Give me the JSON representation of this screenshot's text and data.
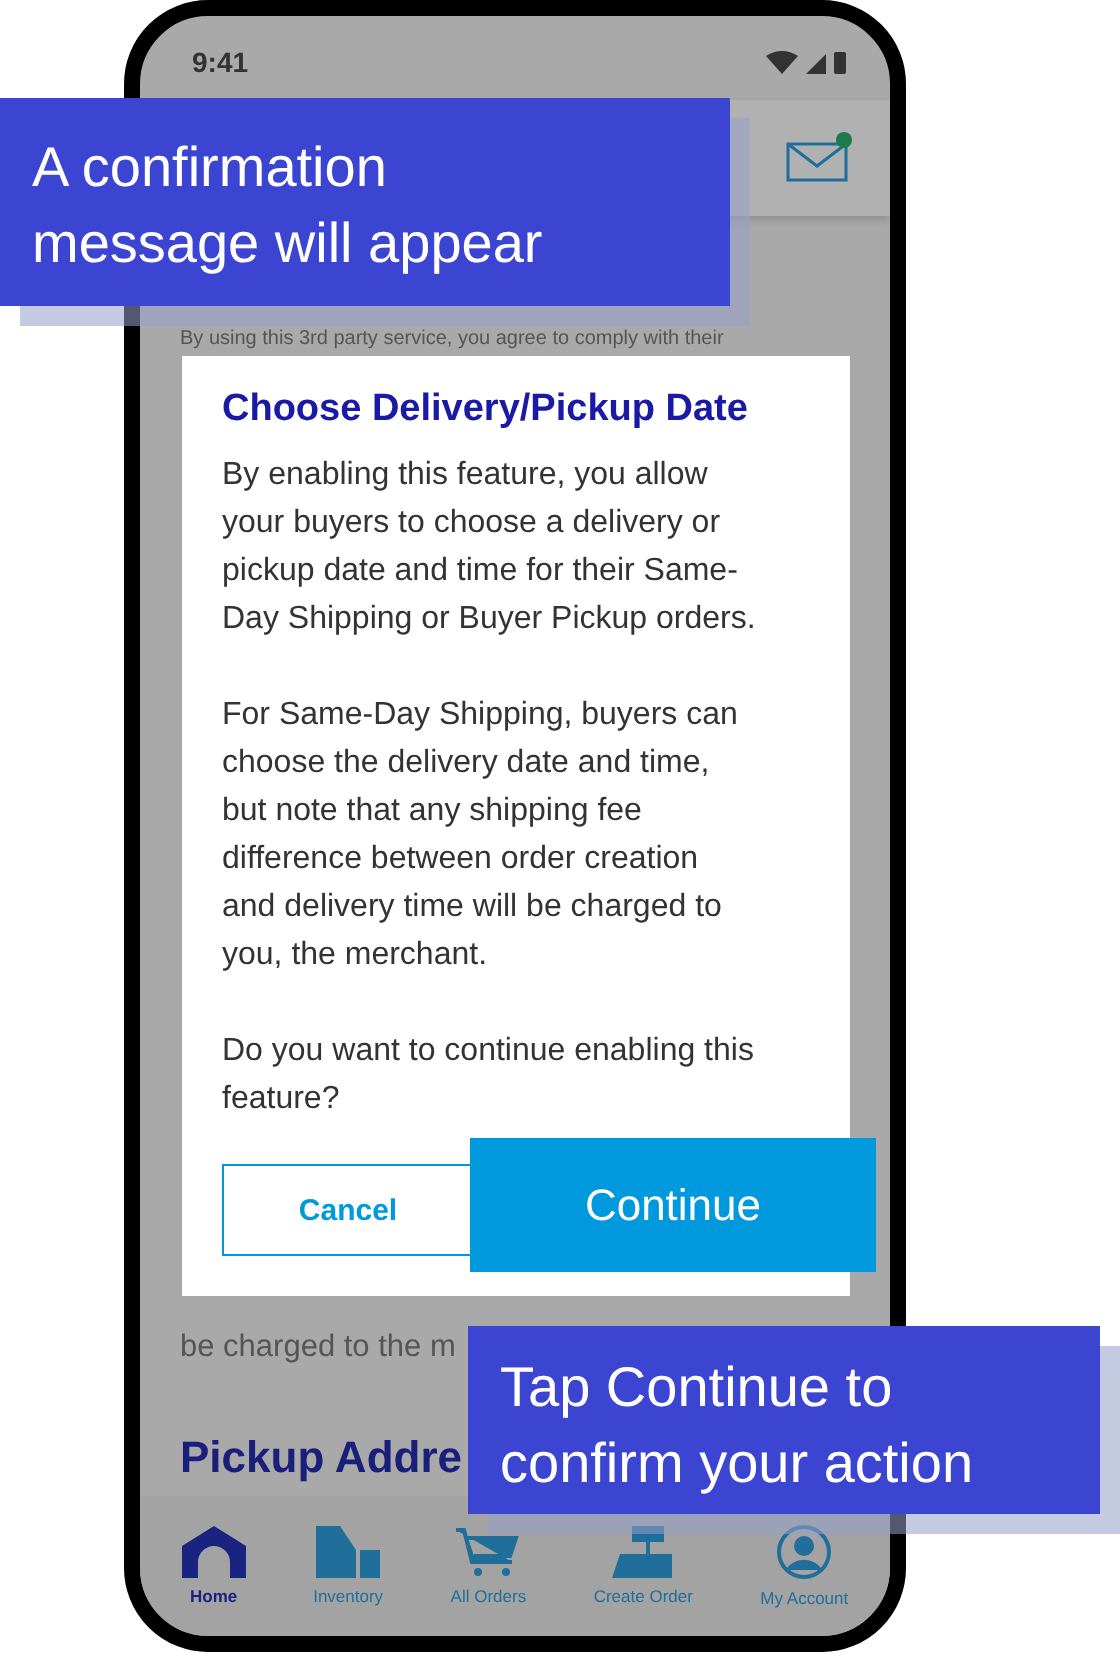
{
  "status_bar": {
    "time": "9:41"
  },
  "background_text": [
    "By using this 3rd party service, you agree to comply with their",
    "be charged to the m"
  ],
  "section_heading": "Pickup Addre",
  "dialog": {
    "title": "Choose Delivery/Pickup Date",
    "paragraphs": [
      "By enabling this feature, you allow your buyers to choose a delivery or pickup date and time for their Same-Day Shipping or Buyer Pickup orders.",
      "For Same-Day Shipping, buyers can choose the delivery date and time, but note that any shipping fee difference between order creation and delivery time will be charged to you, the merchant.",
      "Do you want to continue enabling this feature?"
    ],
    "buttons": [
      {
        "label": "Cancel",
        "kind": "secondary"
      },
      {
        "label": "Continue",
        "kind": "primary"
      }
    ]
  },
  "callouts": [
    {
      "lines": [
        "A confirmation",
        "message will appear"
      ]
    },
    {
      "lines": [
        "Tap Continue to",
        "confirm your action"
      ]
    }
  ],
  "nav": [
    {
      "label": "Home",
      "kind": "home",
      "selected": true
    },
    {
      "label": "Inventory",
      "kind": "inventory",
      "selected": false
    },
    {
      "label": "All Orders",
      "kind": "orders",
      "selected": false
    },
    {
      "label": "Create Order",
      "kind": "create",
      "selected": false
    },
    {
      "label": "My Account",
      "kind": "account",
      "selected": false
    }
  ]
}
